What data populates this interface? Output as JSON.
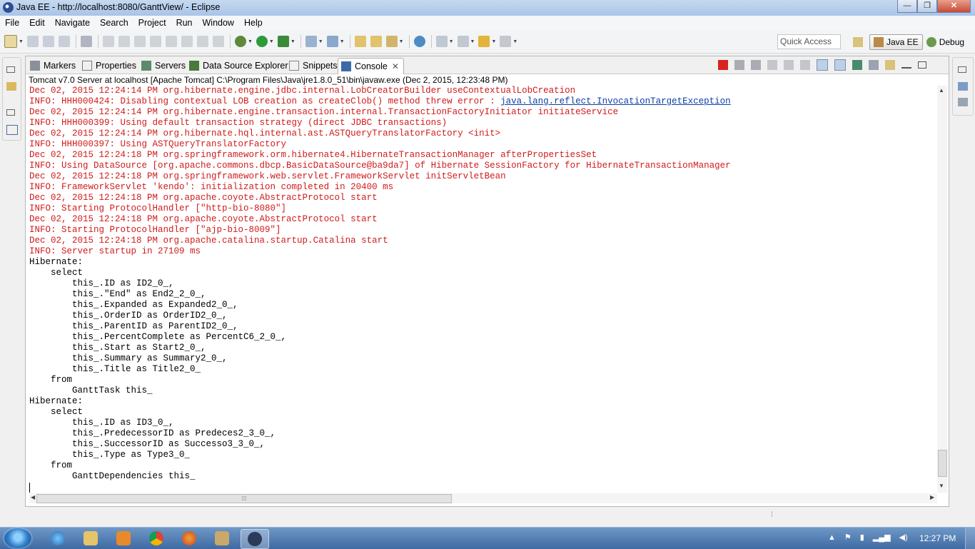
{
  "window": {
    "title": "Java EE - http://localhost:8080/GanttView/ - Eclipse",
    "controls": {
      "minimize": "—",
      "maximize": "❐",
      "close": "✕"
    }
  },
  "menu": [
    "File",
    "Edit",
    "Navigate",
    "Search",
    "Project",
    "Run",
    "Window",
    "Help"
  ],
  "toolbar": {
    "quick_access": "Quick Access",
    "perspectives": [
      {
        "label": "Java EE",
        "active": true
      },
      {
        "label": "Debug",
        "active": false
      }
    ]
  },
  "tabs": [
    {
      "label": "Markers",
      "icon": "markers-icon"
    },
    {
      "label": "Properties",
      "icon": "properties-icon"
    },
    {
      "label": "Servers",
      "icon": "servers-icon"
    },
    {
      "label": "Data Source Explorer",
      "icon": "datasource-icon"
    },
    {
      "label": "Snippets",
      "icon": "snippets-icon"
    },
    {
      "label": "Console",
      "icon": "console-icon",
      "active": true,
      "close": "✕"
    }
  ],
  "console": {
    "process": "Tomcat v7.0 Server at localhost [Apache Tomcat] C:\\Program Files\\Java\\jre1.8.0_51\\bin\\javaw.exe (Dec 2, 2015, 12:23:48 PM)",
    "lines": [
      {
        "text": "Dec 02, 2015 12:24:14 PM org.hibernate.engine.jdbc.internal.LobCreatorBuilder useContextualLobCreation",
        "color": "red"
      },
      {
        "text": "INFO: HHH000424: Disabling contextual LOB creation as createClob() method threw error : ",
        "color": "red",
        "link": "java.lang.reflect.InvocationTargetException"
      },
      {
        "text": "Dec 02, 2015 12:24:14 PM org.hibernate.engine.transaction.internal.TransactionFactoryInitiator initiateService",
        "color": "red"
      },
      {
        "text": "INFO: HHH000399: Using default transaction strategy (direct JDBC transactions)",
        "color": "red"
      },
      {
        "text": "Dec 02, 2015 12:24:14 PM org.hibernate.hql.internal.ast.ASTQueryTranslatorFactory <init>",
        "color": "red"
      },
      {
        "text": "INFO: HHH000397: Using ASTQueryTranslatorFactory",
        "color": "red"
      },
      {
        "text": "Dec 02, 2015 12:24:18 PM org.springframework.orm.hibernate4.HibernateTransactionManager afterPropertiesSet",
        "color": "red"
      },
      {
        "text": "INFO: Using DataSource [org.apache.commons.dbcp.BasicDataSource@ba9da7] of Hibernate SessionFactory for HibernateTransactionManager",
        "color": "red"
      },
      {
        "text": "Dec 02, 2015 12:24:18 PM org.springframework.web.servlet.FrameworkServlet initServletBean",
        "color": "red"
      },
      {
        "text": "INFO: FrameworkServlet 'kendo': initialization completed in 20400 ms",
        "color": "red"
      },
      {
        "text": "Dec 02, 2015 12:24:18 PM org.apache.coyote.AbstractProtocol start",
        "color": "red"
      },
      {
        "text": "INFO: Starting ProtocolHandler [\"http-bio-8080\"]",
        "color": "red"
      },
      {
        "text": "Dec 02, 2015 12:24:18 PM org.apache.coyote.AbstractProtocol start",
        "color": "red"
      },
      {
        "text": "INFO: Starting ProtocolHandler [\"ajp-bio-8009\"]",
        "color": "red"
      },
      {
        "text": "Dec 02, 2015 12:24:18 PM org.apache.catalina.startup.Catalina start",
        "color": "red"
      },
      {
        "text": "INFO: Server startup in 27109 ms",
        "color": "red"
      },
      {
        "text": "Hibernate:",
        "color": "black"
      },
      {
        "text": "    select",
        "color": "black"
      },
      {
        "text": "        this_.ID as ID2_0_,",
        "color": "black"
      },
      {
        "text": "        this_.\"End\" as End2_2_0_,",
        "color": "black"
      },
      {
        "text": "        this_.Expanded as Expanded2_0_,",
        "color": "black"
      },
      {
        "text": "        this_.OrderID as OrderID2_0_,",
        "color": "black"
      },
      {
        "text": "        this_.ParentID as ParentID2_0_,",
        "color": "black"
      },
      {
        "text": "        this_.PercentComplete as PercentC6_2_0_,",
        "color": "black"
      },
      {
        "text": "        this_.Start as Start2_0_,",
        "color": "black"
      },
      {
        "text": "        this_.Summary as Summary2_0_,",
        "color": "black"
      },
      {
        "text": "        this_.Title as Title2_0_",
        "color": "black"
      },
      {
        "text": "    from",
        "color": "black"
      },
      {
        "text": "        GanttTask this_",
        "color": "black"
      },
      {
        "text": "Hibernate:",
        "color": "black"
      },
      {
        "text": "    select",
        "color": "black"
      },
      {
        "text": "        this_.ID as ID3_0_,",
        "color": "black"
      },
      {
        "text": "        this_.PredecessorID as Predeces2_3_0_,",
        "color": "black"
      },
      {
        "text": "        this_.SuccessorID as Successo3_3_0_,",
        "color": "black"
      },
      {
        "text": "        this_.Type as Type3_0_",
        "color": "black"
      },
      {
        "text": "    from",
        "color": "black"
      },
      {
        "text": "        GanttDependencies this_",
        "color": "black"
      }
    ]
  },
  "taskbar": {
    "apps": [
      "internet-explorer-icon",
      "file-explorer-icon",
      "media-player-icon",
      "chrome-icon",
      "firefox-icon",
      "tools-icon",
      "eclipse-icon"
    ],
    "time": "12:27 PM"
  },
  "colors": {
    "console_red": "#d21a1a",
    "link_blue": "#0b3fa8",
    "taskbar": "#3f6aa2"
  }
}
